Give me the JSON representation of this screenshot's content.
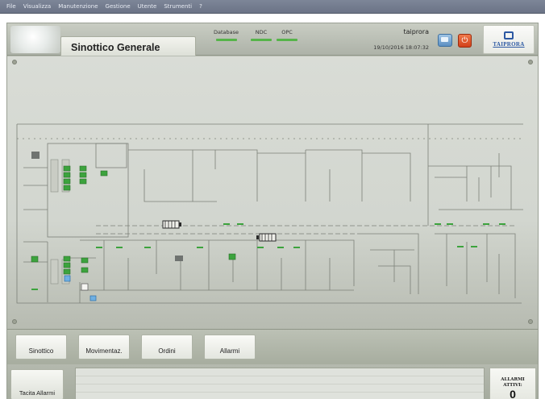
{
  "menubar": {
    "items": [
      "File",
      "Visualizza",
      "Manutenzione",
      "Gestione",
      "Utente",
      "Strumenti",
      "?"
    ]
  },
  "header": {
    "title": "Sinottico Generale",
    "status_indicators": [
      {
        "label": "Database",
        "color": "#56b44a"
      },
      {
        "label": "NDC",
        "color": "#56b44a"
      },
      {
        "label": "OPC",
        "color": "#56b44a"
      }
    ],
    "user": "taiprora",
    "datetime": "19/10/2016 18:07:32",
    "brand": "TAIPRORA",
    "icons": [
      "message-icon",
      "power-icon"
    ]
  },
  "nav": {
    "buttons": [
      "Sinottico",
      "Movimentaz.",
      "Ordini",
      "Allarmi"
    ]
  },
  "footer": {
    "silence_button": "Tacita Allarmi",
    "active_alarms_label": "ALLARMI\nATTIVI:",
    "active_alarms_count": "0"
  },
  "colors": {
    "accent_green": "#56b44a",
    "alarm_red": "#d2401a",
    "brand_blue": "#2c58a3",
    "panel_gray": "#b8bdb2"
  }
}
